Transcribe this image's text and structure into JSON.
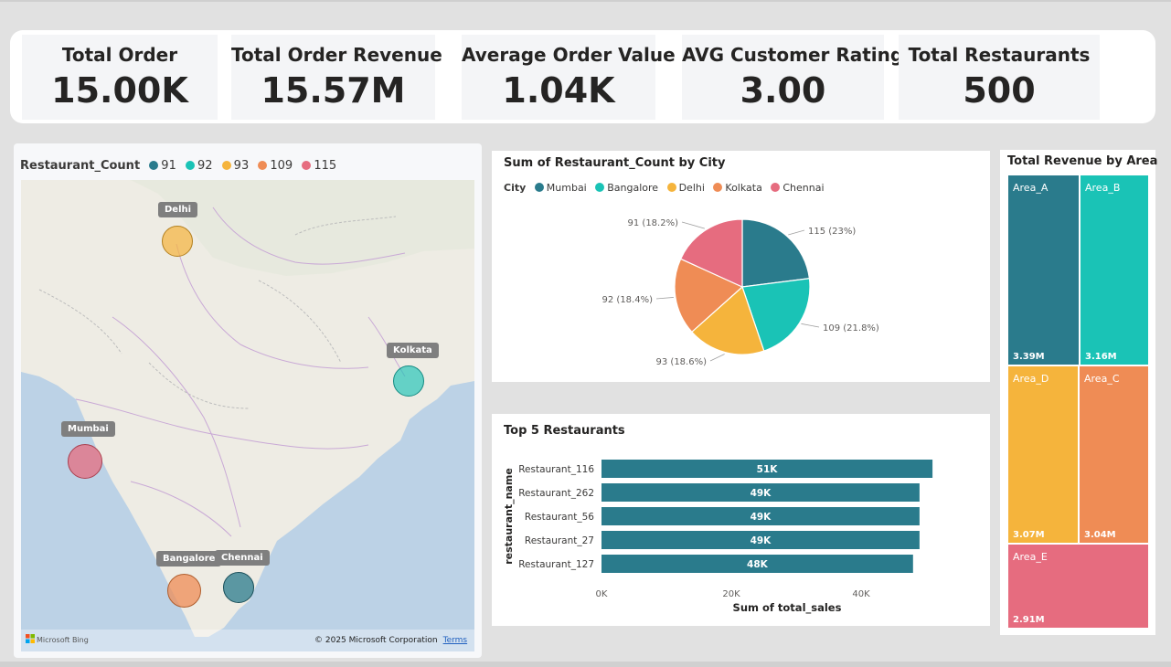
{
  "kpis": [
    {
      "title": "Total Order",
      "value": "15.00K"
    },
    {
      "title": "Total Order Revenue",
      "value": "15.57M"
    },
    {
      "title": "Average Order Value",
      "value": "1.04K"
    },
    {
      "title": "AVG Customer Rating",
      "value": "3.00"
    },
    {
      "title": "Total Restaurants",
      "value": "500"
    }
  ],
  "colors": {
    "c91": "#e66c7f",
    "c92": "#1ac3b6",
    "c93": "#f5b43c",
    "c109": "#ef8c55",
    "c115": "#2a7b8c",
    "bar": "#2a7b8c"
  },
  "map": {
    "legend_title": "Restaurant_Count",
    "legend": [
      {
        "label": "91",
        "color": "#2a7b8c"
      },
      {
        "label": "92",
        "color": "#1ac3b6"
      },
      {
        "label": "93",
        "color": "#f5b43c"
      },
      {
        "label": "109",
        "color": "#ef8c55"
      },
      {
        "label": "115",
        "color": "#e66c7f"
      }
    ],
    "cities": {
      "delhi": "Delhi",
      "kolkata": "Kolkata",
      "mumbai": "Mumbai",
      "bangalore": "Bangalore",
      "chennai": "Chennai"
    },
    "copyright": "© 2025 Microsoft Corporation",
    "terms": "Terms",
    "bing": "Microsoft Bing"
  },
  "pie": {
    "title": "Sum of Restaurant_Count by City",
    "legend_title": "City",
    "legend": [
      "Mumbai",
      "Bangalore",
      "Delhi",
      "Kolkata",
      "Chennai"
    ],
    "labels": [
      "115 (23%)",
      "109 (21.8%)",
      "93 (18.6%)",
      "92 (18.4%)",
      "91 (18.2%)"
    ]
  },
  "bar": {
    "title": "Top 5 Restaurants",
    "ylabel": "restaurant_name",
    "xlabel": "Sum of total_sales",
    "xticks": [
      "0K",
      "20K",
      "40K"
    ]
  },
  "treemap": {
    "title": "Total Revenue by Area",
    "tiles": [
      {
        "name": "Area_A",
        "value": "3.39M",
        "color": "#2a7b8c"
      },
      {
        "name": "Area_B",
        "value": "3.16M",
        "color": "#1ac3b6"
      },
      {
        "name": "Area_D",
        "value": "3.07M",
        "color": "#f5b43c"
      },
      {
        "name": "Area_C",
        "value": "3.04M",
        "color": "#ef8c55"
      },
      {
        "name": "Area_E",
        "value": "2.91M",
        "color": "#e66c7f"
      }
    ]
  },
  "chart_data": [
    {
      "type": "pie",
      "title": "Sum of Restaurant_Count by City",
      "categories": [
        "Mumbai",
        "Bangalore",
        "Delhi",
        "Kolkata",
        "Chennai"
      ],
      "values": [
        115,
        109,
        93,
        92,
        91
      ],
      "colors": [
        "#2a7b8c",
        "#1ac3b6",
        "#f5b43c",
        "#ef8c55",
        "#e66c7f"
      ],
      "legend": "top-left"
    },
    {
      "type": "bar",
      "title": "Top 5 Restaurants",
      "orientation": "horizontal",
      "categories": [
        "Restaurant_116",
        "Restaurant_262",
        "Restaurant_56",
        "Restaurant_27",
        "Restaurant_127"
      ],
      "values": [
        51000,
        49000,
        49000,
        49000,
        48000
      ],
      "data_labels": [
        "51K",
        "49K",
        "49K",
        "49K",
        "48K"
      ],
      "xlabel": "Sum of total_sales",
      "ylabel": "restaurant_name",
      "xlim": [
        0,
        51000
      ],
      "grid": false
    }
  ]
}
